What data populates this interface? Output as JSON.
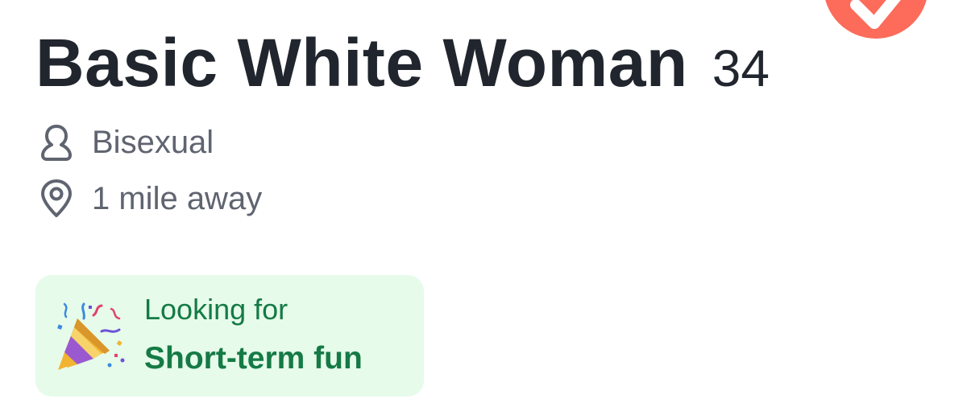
{
  "profile": {
    "name": "Basic White Woman",
    "age": "34",
    "orientation": "Bisexual",
    "distance": "1 mile away"
  },
  "looking_for": {
    "label": "Looking for",
    "value": "Short-term fun"
  },
  "icons": {
    "corner": "like-check-icon",
    "orientation": "person-icon",
    "distance": "location-pin-icon",
    "looking_for": "party-popper-icon"
  },
  "colors": {
    "name_text": "#21262e",
    "secondary_text": "#5f6470",
    "card_background": "#e6fbea",
    "card_text": "#157a45",
    "badge": "#fd6b5a"
  }
}
